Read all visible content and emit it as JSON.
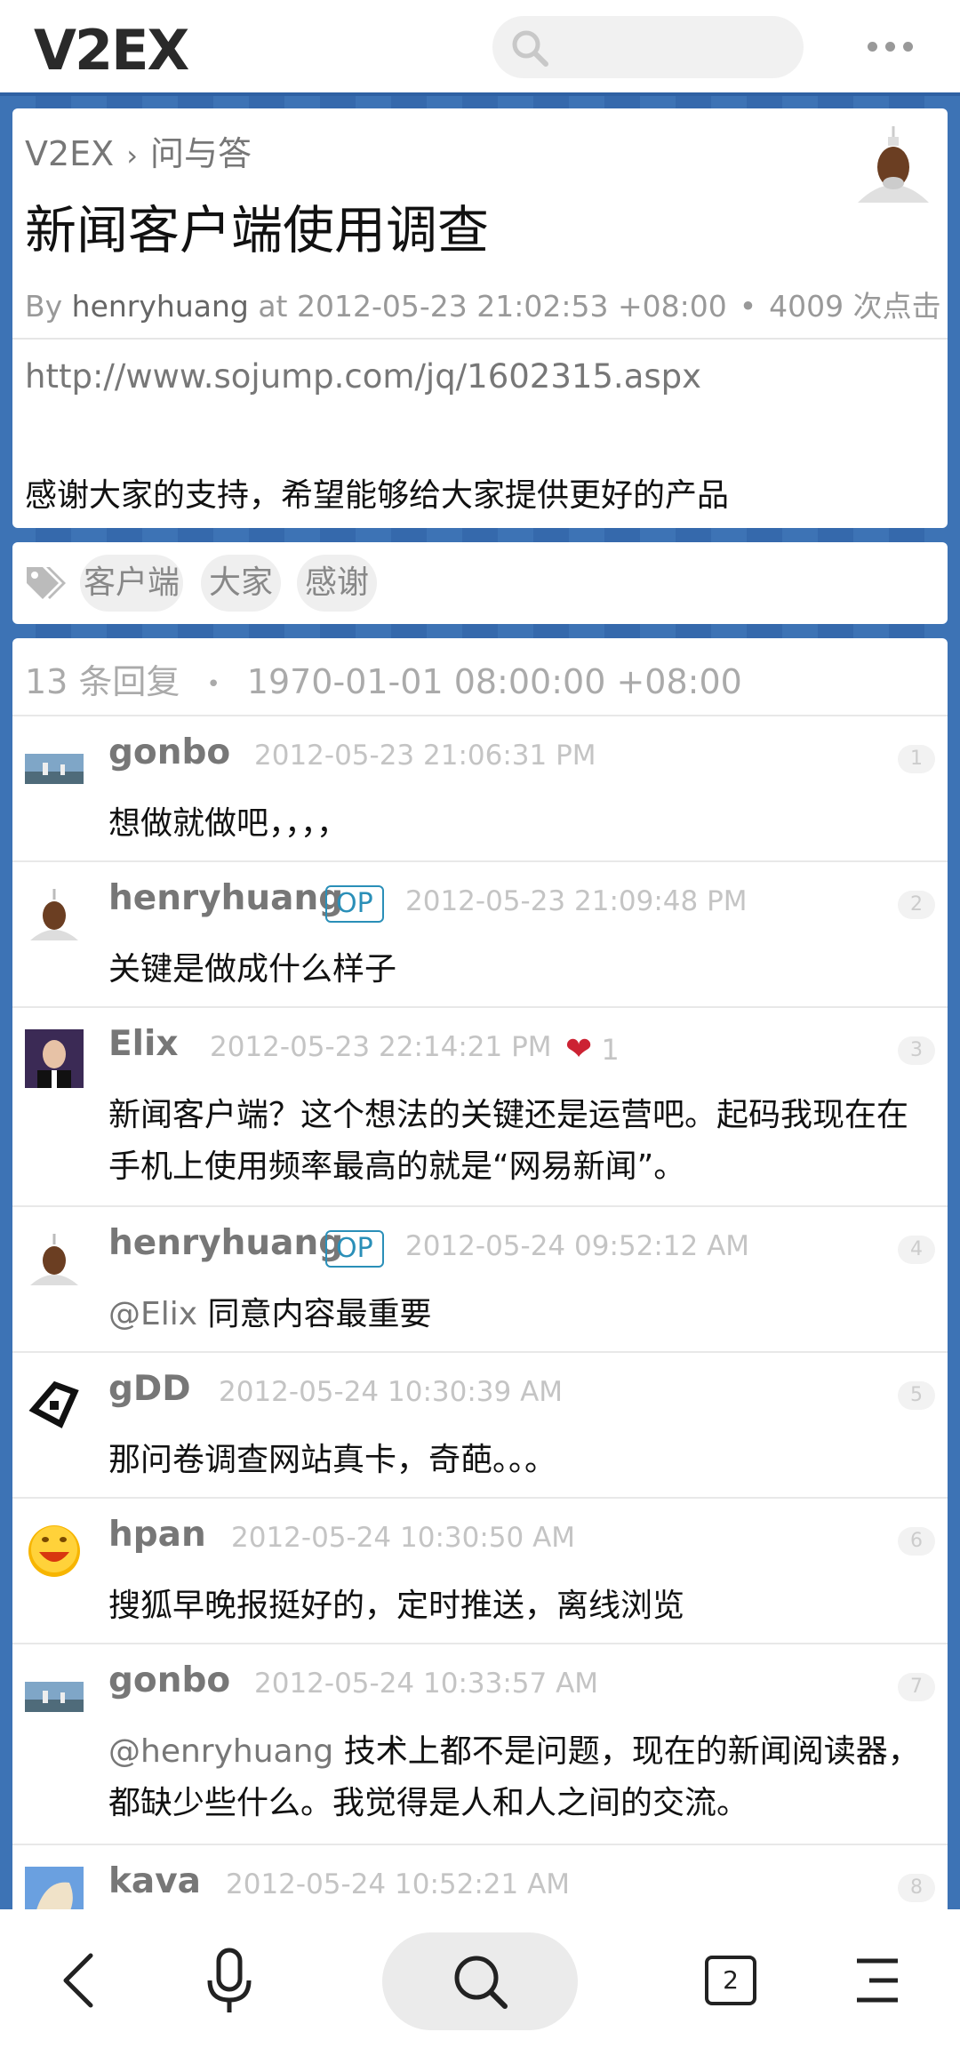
{
  "app": {
    "logo": "V2EX"
  },
  "breadcrumb": {
    "root": "V2EX",
    "separator": "›",
    "node": "问与答"
  },
  "topic": {
    "title": "新闻客户端使用调查",
    "by": "By",
    "author": "henryhuang",
    "at": "at 2012-05-23 21:02:53 +08:00",
    "dot": "•",
    "clicks": "4009 次点击",
    "link": "http://www.sojump.com/jq/1602315.aspx",
    "content": "感谢大家的支持，希望能够给大家提供更好的产品"
  },
  "tags": [
    "客户端",
    "大家",
    "感谢"
  ],
  "replies_header": {
    "count": "13 条回复",
    "dot": "•",
    "time": "1970-01-01 08:00:00 +08:00"
  },
  "replies": [
    {
      "user": "gonbo",
      "op": "",
      "time": "2012-05-23 21:06:31 PM",
      "num": "1",
      "content": "想做就做吧，，，，",
      "mention": ""
    },
    {
      "user": "henryhuang",
      "op": "OP",
      "time": "2012-05-23 21:09:48 PM",
      "num": "2",
      "content": "关键是做成什么样子",
      "mention": ""
    },
    {
      "user": "Elix",
      "op": "",
      "time": "2012-05-23 22:14:21 PM",
      "num": "3",
      "likes": "1",
      "content": "新闻客户端？这个想法的关键还是运营吧。起码我现在在手机上使用频率最高的就是“网易新闻”。",
      "mention": ""
    },
    {
      "user": "henryhuang",
      "op": "OP",
      "time": "2012-05-24 09:52:12 AM",
      "num": "4",
      "mention": "@Elix",
      "content": " 同意内容最重要"
    },
    {
      "user": "gDD",
      "op": "",
      "time": "2012-05-24 10:30:39 AM",
      "num": "5",
      "content": "那问卷调查网站真卡，奇葩。。。",
      "mention": ""
    },
    {
      "user": "hpan",
      "op": "",
      "time": "2012-05-24 10:30:50 AM",
      "num": "6",
      "content": "搜狐早晚报挺好的，定时推送，离线浏览",
      "mention": ""
    },
    {
      "user": "gonbo",
      "op": "",
      "time": "2012-05-24 10:33:57 AM",
      "num": "7",
      "mention": "@henryhuang",
      "content": " 技术上都不是问题，现在的新闻阅读器，都缺少些什么。我觉得是人和人之间的交流。"
    },
    {
      "user": "kava",
      "op": "",
      "time": "2012-05-24 10:52:21 AM",
      "num": "8",
      "content": "",
      "mention": ""
    }
  ],
  "bottom_nav": {
    "tab_count": "2"
  },
  "colors": {
    "accent": "#2a8fb8",
    "background": "#3a6fb0",
    "heart": "#cc2233"
  }
}
